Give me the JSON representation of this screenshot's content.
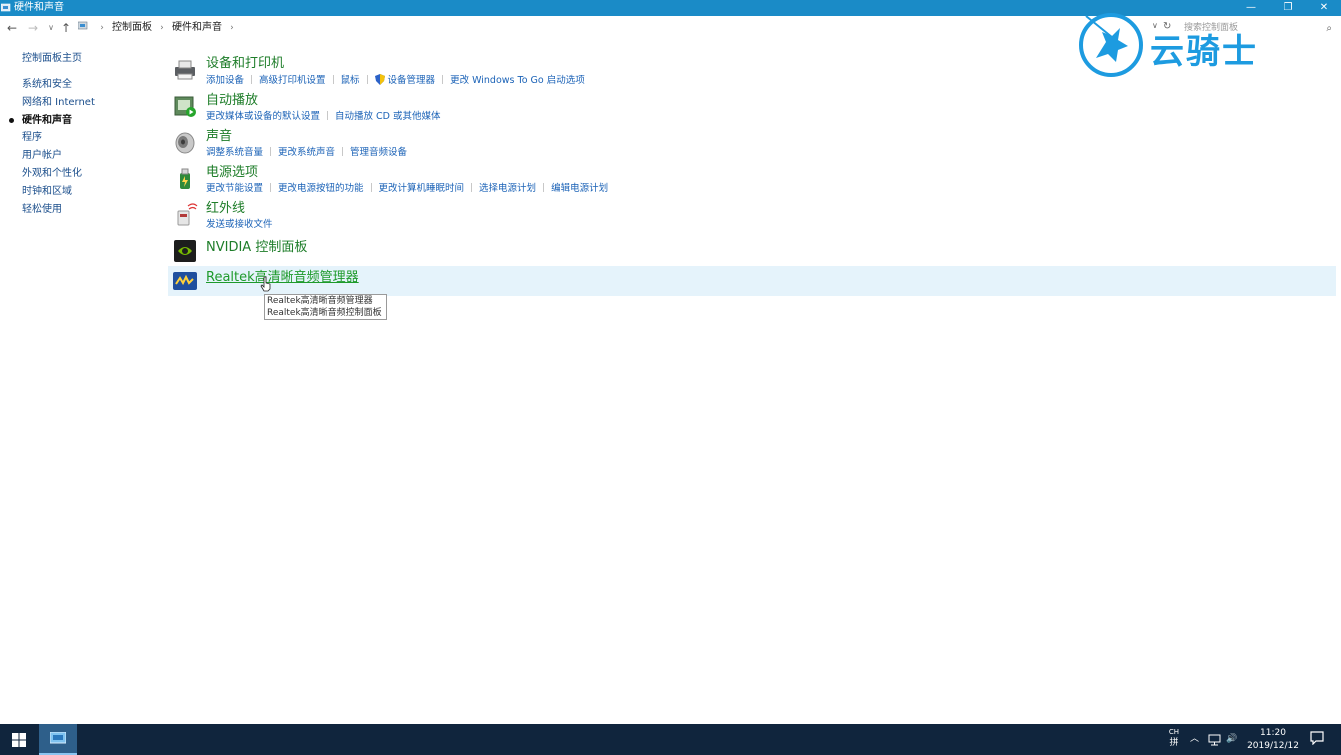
{
  "window": {
    "title": "硬件和声音",
    "minimize_glyph": "—",
    "maximize_glyph": "❐",
    "close_glyph": "✕"
  },
  "address": {
    "back_glyph": "←",
    "forward_glyph": "→",
    "recent_glyph": "∨",
    "up_glyph": "↑",
    "breadcrumb": [
      "控制面板",
      "硬件和声音"
    ],
    "separator": "›",
    "search_placeholder": "搜索控制面板",
    "refresh_glyph": "↻",
    "dropdown_glyph": "∨",
    "search_icon": "⌕"
  },
  "watermark": {
    "text": "云骑士"
  },
  "sidebar": {
    "items": [
      {
        "label": "控制面板主页",
        "active": false
      },
      {
        "label": "系统和安全",
        "active": false
      },
      {
        "label": "网络和 Internet",
        "active": false
      },
      {
        "label": "硬件和声音",
        "active": true
      },
      {
        "label": "程序",
        "active": false
      },
      {
        "label": "用户帐户",
        "active": false
      },
      {
        "label": "外观和个性化",
        "active": false
      },
      {
        "label": "时钟和区域",
        "active": false
      },
      {
        "label": "轻松使用",
        "active": false
      }
    ]
  },
  "categories": [
    {
      "title": "设备和打印机",
      "icon": "printer-icon",
      "links": [
        "添加设备",
        "高级打印机设置",
        "鼠标",
        "设备管理器",
        "更改 Windows To Go 启动选项"
      ]
    },
    {
      "title": "自动播放",
      "icon": "autoplay-icon",
      "links": [
        "更改媒体或设备的默认设置",
        "自动播放 CD 或其他媒体"
      ]
    },
    {
      "title": "声音",
      "icon": "speaker-icon",
      "links": [
        "调整系统音量",
        "更改系统声音",
        "管理音频设备"
      ]
    },
    {
      "title": "电源选项",
      "icon": "power-icon",
      "links": [
        "更改节能设置",
        "更改电源按钮的功能",
        "更改计算机睡眠时间",
        "选择电源计划",
        "编辑电源计划"
      ]
    },
    {
      "title": "红外线",
      "icon": "infrared-icon",
      "links": [
        "发送或接收文件"
      ]
    },
    {
      "title": "NVIDIA 控制面板",
      "icon": "nvidia-icon",
      "links": []
    },
    {
      "title": "Realtek高清晰音频管理器",
      "icon": "realtek-icon",
      "links": []
    }
  ],
  "tooltip": {
    "lines": [
      "Realtek高清晰音频管理器",
      "Realtek高清晰音频控制面板"
    ]
  },
  "taskbar": {
    "ime_lines": [
      "CH",
      "拼"
    ],
    "tray_up_glyph": "︿",
    "volume_glyph": "🔊",
    "time": "11:20",
    "date": "2019/12/12"
  },
  "colors": {
    "titlebar": "#1a8bc7",
    "category_title": "#1e7d29",
    "link": "#1c63b7",
    "hover_row": "#e5f3fb",
    "taskbar": "#10253d"
  }
}
